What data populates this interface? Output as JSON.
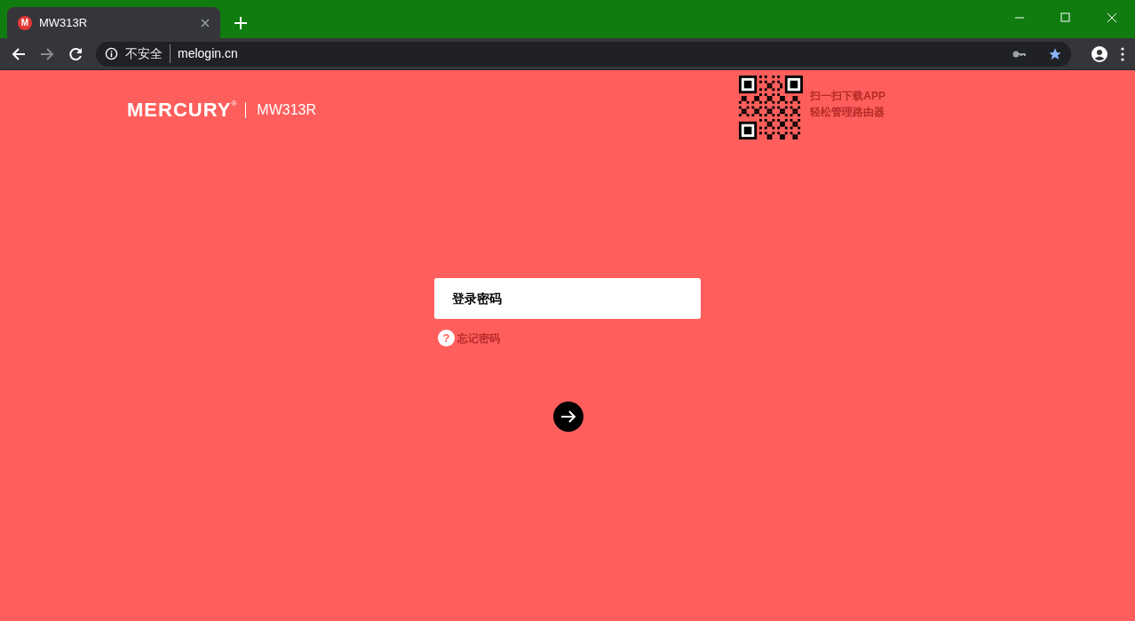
{
  "browser": {
    "tab": {
      "title": "MW313R",
      "favicon": "M"
    },
    "address": {
      "security": "不安全",
      "url": "melogin.cn"
    }
  },
  "header": {
    "brand": "MERCURY",
    "brand_mark": "®",
    "model": "MW313R",
    "qr_caption": [
      "扫一扫下载APP",
      "轻松管理路由器"
    ]
  },
  "login": {
    "password_placeholder": "登录密码",
    "forgot_icon": "?",
    "forgot_link": "忘记密码"
  }
}
